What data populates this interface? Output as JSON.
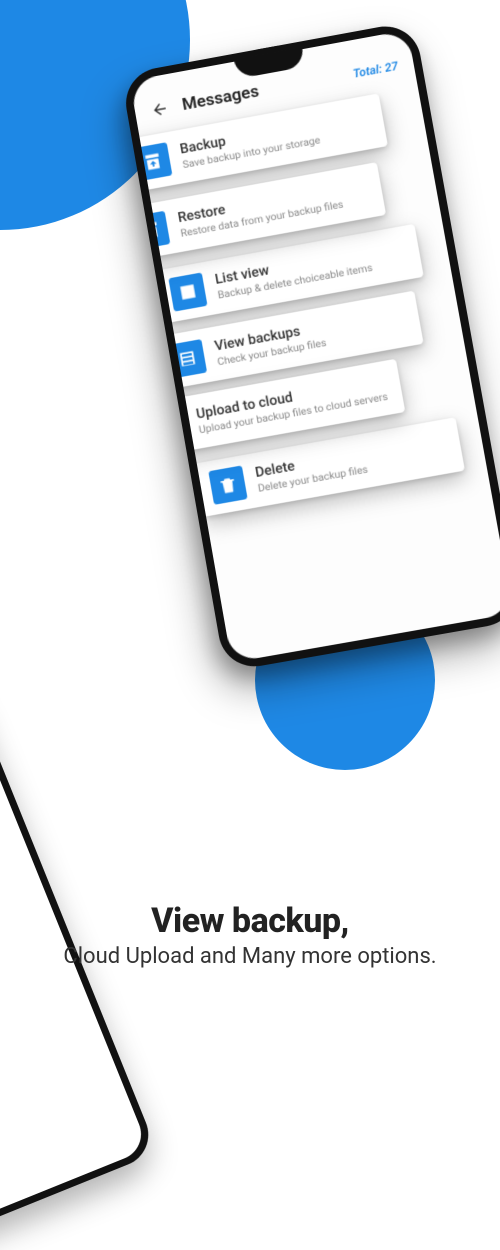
{
  "header": {
    "title": "Messages",
    "total_label": "Total:",
    "total_value": "27"
  },
  "cards": [
    {
      "title": "Backup",
      "subtitle": "Save backup into your storage",
      "icon": "archive-down-icon"
    },
    {
      "title": "Restore",
      "subtitle": "Restore data from your backup files",
      "icon": "archive-up-icon"
    },
    {
      "title": "List view",
      "subtitle": "Backup & delete choiceable items",
      "icon": "list-icon"
    },
    {
      "title": "View backups",
      "subtitle": "Check your backup files",
      "icon": "grid-icon"
    },
    {
      "title": "Upload to cloud",
      "subtitle": "Upload your backup files to cloud servers",
      "icon": "cloud-upload-icon"
    },
    {
      "title": "Delete",
      "subtitle": "Delete your backup files",
      "icon": "trash-icon"
    }
  ],
  "caption": {
    "line1": "View backup,",
    "line2": "Cloud Upload and Many more options."
  },
  "colors": {
    "accent": "#1e88e5"
  }
}
